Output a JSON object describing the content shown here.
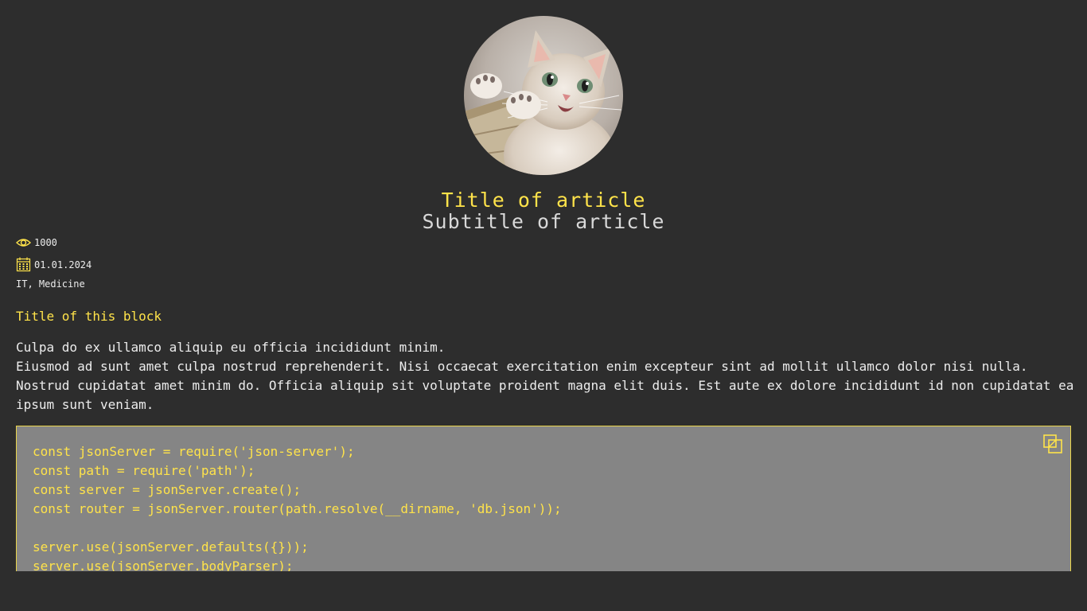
{
  "article": {
    "title": "Title of article",
    "subtitle": "Subtitle of article",
    "views": "1000",
    "date": "01.01.2024",
    "tags": "IT, Medicine",
    "avatar_alt": "kitten photo"
  },
  "block": {
    "title": "Title of this block",
    "paragraphs": [
      "Culpa do ex ullamco aliquip eu officia incididunt minim.",
      "Eiusmod ad sunt amet culpa nostrud reprehenderit. Nisi occaecat exercitation enim excepteur sint ad mollit ullamco dolor nisi nulla.",
      "Nostrud cupidatat amet minim do. Officia aliquip sit voluptate proident magna elit duis. Est aute ex dolore incididunt id non cupidatat ea",
      "ipsum sunt veniam."
    ]
  },
  "code": {
    "lines": [
      "const jsonServer = require('json-server');",
      "const path = require('path');",
      "const server = jsonServer.create();",
      "const router = jsonServer.router(path.resolve(__dirname, 'db.json'));",
      "",
      "server.use(jsonServer.defaults({}));",
      "server.use(jsonServer.bodyParser);"
    ]
  },
  "icons": {
    "views": "eye-icon",
    "date": "calendar-icon",
    "copy": "copy-icon"
  },
  "colors": {
    "background": "#2d2d2d",
    "accent": "#ffe34a",
    "code_background": "#858585"
  }
}
